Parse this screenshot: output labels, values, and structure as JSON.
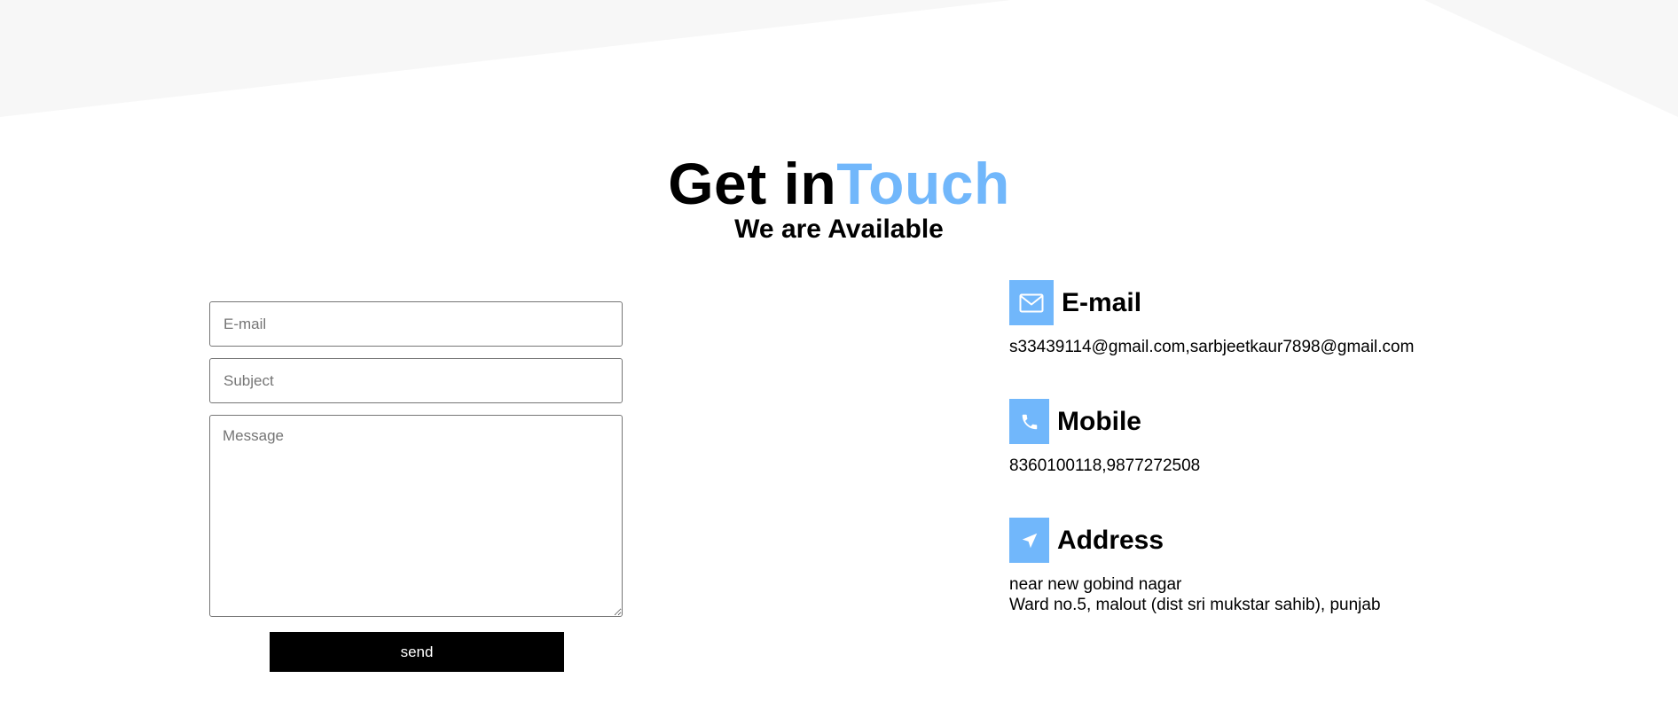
{
  "heading": {
    "title_main": "Get in",
    "title_accent": "Touch",
    "subtitle": "We are Available"
  },
  "form": {
    "email_placeholder": "E-mail",
    "subject_placeholder": "Subject",
    "message_placeholder": "Message",
    "send_label": "send"
  },
  "contact": {
    "email": {
      "icon": "envelope-icon",
      "label": "E-mail",
      "value": "s33439114@gmail.com,sarbjeetkaur7898@gmail.com"
    },
    "mobile": {
      "icon": "phone-icon",
      "label": "Mobile",
      "value": "8360100118,9877272508"
    },
    "address": {
      "icon": "location-arrow-icon",
      "label": "Address",
      "line1": "near new gobind nagar",
      "line2": "Ward no.5, malout (dist sri mukstar sahib), punjab"
    }
  },
  "colors": {
    "accent": "#71b7fb",
    "background_shape": "#f7f7f7",
    "button": "#000000"
  }
}
